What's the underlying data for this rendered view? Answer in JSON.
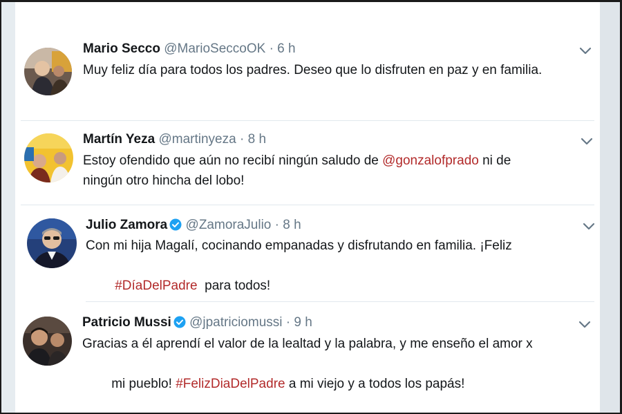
{
  "tweets": [
    {
      "name": "Mario Secco",
      "handle": "@MarioSeccoOK",
      "separator": "·",
      "time": "6 h",
      "verified": false,
      "text_lines": [
        [
          {
            "text": "Muy feliz día para todos los padres. Deseo que lo disfruten en paz y en familia.",
            "link": false
          }
        ]
      ]
    },
    {
      "name": "Martín Yeza",
      "handle": "@martinyeza",
      "separator": "·",
      "time": "8 h",
      "verified": false,
      "text_lines": [
        [
          {
            "text": "Estoy ofendido que aún no recibí ningún saludo de ",
            "link": false
          },
          {
            "text": "@gonzalofprado",
            "link": true
          },
          {
            "text": " ni de",
            "link": false
          }
        ],
        [
          {
            "text": "ningún otro hincha del lobo!",
            "link": false
          }
        ]
      ]
    },
    {
      "name": "Julio Zamora",
      "handle": "@ZamoraJulio",
      "separator": "·",
      "time": "8 h",
      "verified": true,
      "text_lines": [
        [
          {
            "text": "Con mi hija Magalí, cocinando empanadas y disfrutando en familia. ¡Feliz",
            "link": false
          }
        ],
        [
          {
            "text": "#DíaDelPadre",
            "link": true
          },
          {
            "text": "  para todos!",
            "link": false
          }
        ]
      ]
    },
    {
      "name": "Patricio Mussi",
      "handle": "@jpatriciomussi",
      "separator": "·",
      "time": "9 h",
      "verified": true,
      "text_lines": [
        [
          {
            "text": "Gracias a él aprendí el valor de la lealtad y la palabra, y me enseño el amor x",
            "link": false
          }
        ],
        [
          {
            "text": "mi pueblo! ",
            "link": false
          },
          {
            "text": "#FelizDiaDelPadre",
            "link": true
          },
          {
            "text": " a mi viejo y a todos los papás!",
            "link": false
          }
        ]
      ]
    }
  ],
  "icons": {
    "verified": "verified-badge-icon",
    "caret": "chevron-down-icon"
  },
  "colors": {
    "link": "#b22a2a",
    "verified": "#1da1f2",
    "secondary_text": "#657786"
  }
}
